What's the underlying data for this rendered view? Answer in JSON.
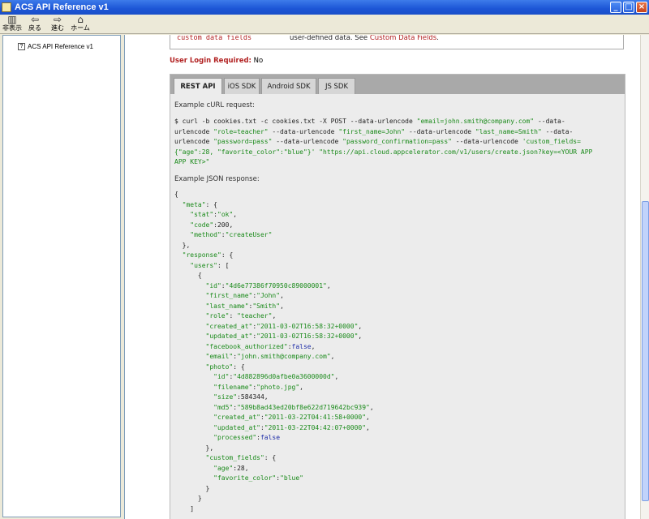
{
  "window": {
    "title": "ACS API Reference v1",
    "min_label": "_",
    "max_label": "□",
    "close_label": "×"
  },
  "toolbar": {
    "hide": "非表示",
    "back": "戻る",
    "forward": "進む",
    "home": "ホーム"
  },
  "tree": {
    "items": [
      {
        "label": "ACS API Reference v1"
      }
    ]
  },
  "content": {
    "prev_row": {
      "field": "custom data fields",
      "desc_prefix": "user-defined data. See ",
      "desc_link": "Custom Data Fields",
      "desc_suffix": "."
    },
    "login": {
      "label": "User Login Required:",
      "value": "No"
    },
    "tabs": [
      {
        "label": "REST API",
        "active": true
      },
      {
        "label": "iOS SDK",
        "active": false
      },
      {
        "label": "Android SDK",
        "active": false
      },
      {
        "label": "JS SDK",
        "active": false
      }
    ],
    "curl_label": "Example cURL request:",
    "curl_lines": [
      [
        [
          "n",
          "$ curl -b cookies.txt -c cookies.txt -X POST --data-urlencode "
        ],
        [
          "s",
          "\"email=john.smith@company.com\""
        ],
        [
          "n",
          " --data-"
        ]
      ],
      [
        [
          "n",
          "urlencode "
        ],
        [
          "s",
          "\"role=teacher\""
        ],
        [
          "n",
          " --data-urlencode "
        ],
        [
          "s",
          "\"first_name=John\""
        ],
        [
          "n",
          " --data-urlencode "
        ],
        [
          "s",
          "\"last_name=Smith\""
        ],
        [
          "n",
          " --data-"
        ]
      ],
      [
        [
          "n",
          "urlencode "
        ],
        [
          "s",
          "\"password=pass\""
        ],
        [
          "n",
          " --data-urlencode "
        ],
        [
          "s",
          "\"password_confirmation=pass\""
        ],
        [
          "n",
          " --data-urlencode "
        ],
        [
          "s",
          "'custom_fields="
        ]
      ],
      [
        [
          "s",
          "{\"age\":28, \"favorite_color\":\"blue\"}'"
        ],
        [
          "n",
          " "
        ],
        [
          "s",
          "\"https://api.cloud.appcelerator.com/v1/users/create.json?key=<YOUR APP"
        ]
      ],
      [
        [
          "s",
          "APP KEY>\""
        ]
      ]
    ],
    "json_label": "Example JSON response:",
    "json_lines": [
      [
        [
          "n",
          "{"
        ]
      ],
      [
        [
          "n",
          "  "
        ],
        [
          "s",
          "\"meta\""
        ],
        [
          "n",
          ": {"
        ]
      ],
      [
        [
          "n",
          "    "
        ],
        [
          "s",
          "\"stat\""
        ],
        [
          "n",
          ":"
        ],
        [
          "s",
          "\"ok\""
        ],
        [
          "n",
          ","
        ]
      ],
      [
        [
          "n",
          "    "
        ],
        [
          "s",
          "\"code\""
        ],
        [
          "n",
          ":200,"
        ]
      ],
      [
        [
          "n",
          "    "
        ],
        [
          "s",
          "\"method\""
        ],
        [
          "n",
          ":"
        ],
        [
          "s",
          "\"createUser\""
        ]
      ],
      [
        [
          "n",
          "  },"
        ]
      ],
      [
        [
          "n",
          "  "
        ],
        [
          "s",
          "\"response\""
        ],
        [
          "n",
          ": {"
        ]
      ],
      [
        [
          "n",
          "    "
        ],
        [
          "s",
          "\"users\""
        ],
        [
          "n",
          ": ["
        ]
      ],
      [
        [
          "n",
          "      {"
        ]
      ],
      [
        [
          "n",
          "        "
        ],
        [
          "s",
          "\"id\""
        ],
        [
          "n",
          ":"
        ],
        [
          "s",
          "\"4d6e77386f70950c89000001\""
        ],
        [
          "n",
          ","
        ]
      ],
      [
        [
          "n",
          "        "
        ],
        [
          "s",
          "\"first_name\""
        ],
        [
          "n",
          ":"
        ],
        [
          "s",
          "\"John\""
        ],
        [
          "n",
          ","
        ]
      ],
      [
        [
          "n",
          "        "
        ],
        [
          "s",
          "\"last_name\""
        ],
        [
          "n",
          ":"
        ],
        [
          "s",
          "\"Smith\""
        ],
        [
          "n",
          ","
        ]
      ],
      [
        [
          "n",
          "        "
        ],
        [
          "s",
          "\"role\""
        ],
        [
          "n",
          ": "
        ],
        [
          "s",
          "\"teacher\""
        ],
        [
          "n",
          ","
        ]
      ],
      [
        [
          "n",
          "        "
        ],
        [
          "s",
          "\"created_at\""
        ],
        [
          "n",
          ":"
        ],
        [
          "s",
          "\"2011-03-02T16:58:32+0000\""
        ],
        [
          "n",
          ","
        ]
      ],
      [
        [
          "n",
          "        "
        ],
        [
          "s",
          "\"updated_at\""
        ],
        [
          "n",
          ":"
        ],
        [
          "s",
          "\"2011-03-02T16:58:32+0000\""
        ],
        [
          "n",
          ","
        ]
      ],
      [
        [
          "n",
          "        "
        ],
        [
          "s",
          "\"facebook_authorized\""
        ],
        [
          "n",
          ":"
        ],
        [
          "k",
          "false"
        ],
        [
          "n",
          ","
        ]
      ],
      [
        [
          "n",
          "        "
        ],
        [
          "s",
          "\"email\""
        ],
        [
          "n",
          ":"
        ],
        [
          "s",
          "\"john.smith@company.com\""
        ],
        [
          "n",
          ","
        ]
      ],
      [
        [
          "n",
          "        "
        ],
        [
          "s",
          "\"photo\""
        ],
        [
          "n",
          ": {"
        ]
      ],
      [
        [
          "n",
          "          "
        ],
        [
          "s",
          "\"id\""
        ],
        [
          "n",
          ":"
        ],
        [
          "s",
          "\"4d882896d0afbe0a3600000d\""
        ],
        [
          "n",
          ","
        ]
      ],
      [
        [
          "n",
          "          "
        ],
        [
          "s",
          "\"filename\""
        ],
        [
          "n",
          ":"
        ],
        [
          "s",
          "\"photo.jpg\""
        ],
        [
          "n",
          ","
        ]
      ],
      [
        [
          "n",
          "          "
        ],
        [
          "s",
          "\"size\""
        ],
        [
          "n",
          ":584344,"
        ]
      ],
      [
        [
          "n",
          "          "
        ],
        [
          "s",
          "\"md5\""
        ],
        [
          "n",
          ":"
        ],
        [
          "s",
          "\"589b8ad43ed20bf8e622d719642bc939\""
        ],
        [
          "n",
          ","
        ]
      ],
      [
        [
          "n",
          "          "
        ],
        [
          "s",
          "\"created_at\""
        ],
        [
          "n",
          ":"
        ],
        [
          "s",
          "\"2011-03-22T04:41:58+0000\""
        ],
        [
          "n",
          ","
        ]
      ],
      [
        [
          "n",
          "          "
        ],
        [
          "s",
          "\"updated_at\""
        ],
        [
          "n",
          ":"
        ],
        [
          "s",
          "\"2011-03-22T04:42:07+0000\""
        ],
        [
          "n",
          ","
        ]
      ],
      [
        [
          "n",
          "          "
        ],
        [
          "s",
          "\"processed\""
        ],
        [
          "n",
          ":"
        ],
        [
          "k",
          "false"
        ]
      ],
      [
        [
          "n",
          "        },"
        ]
      ],
      [
        [
          "n",
          "        "
        ],
        [
          "s",
          "\"custom_fields\""
        ],
        [
          "n",
          ": {"
        ]
      ],
      [
        [
          "n",
          "          "
        ],
        [
          "s",
          "\"age\""
        ],
        [
          "n",
          ":28,"
        ]
      ],
      [
        [
          "n",
          "          "
        ],
        [
          "s",
          "\"favorite_color\""
        ],
        [
          "n",
          ":"
        ],
        [
          "s",
          "\"blue\""
        ]
      ],
      [
        [
          "n",
          "        }"
        ]
      ],
      [
        [
          "n",
          "      }"
        ]
      ],
      [
        [
          "n",
          "    ]"
        ]
      ]
    ]
  }
}
